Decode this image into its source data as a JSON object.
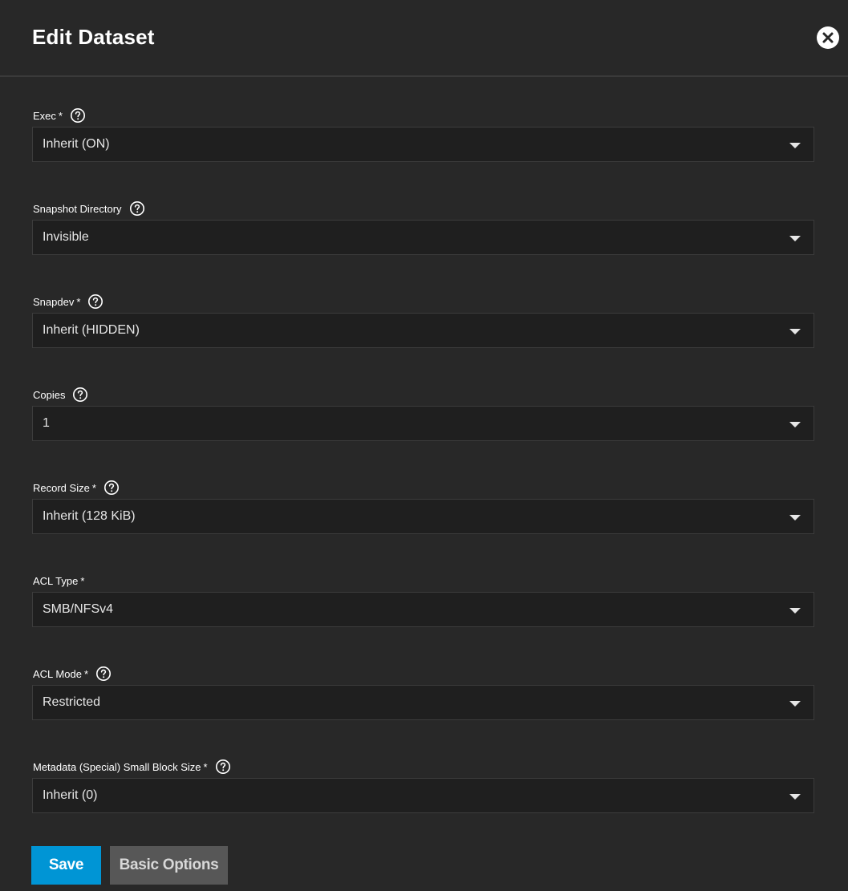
{
  "dialog": {
    "title": "Edit Dataset",
    "close_icon": "close-icon"
  },
  "fields": [
    {
      "label": "Exec",
      "required": "*",
      "has_help": true,
      "value": "Inherit (ON)"
    },
    {
      "label": "Snapshot Directory",
      "required": "",
      "has_help": true,
      "value": "Invisible"
    },
    {
      "label": "Snapdev",
      "required": "*",
      "has_help": true,
      "value": "Inherit (HIDDEN)"
    },
    {
      "label": "Copies",
      "required": "",
      "has_help": true,
      "value": "1"
    },
    {
      "label": "Record Size",
      "required": "*",
      "has_help": true,
      "value": "Inherit (128 KiB)"
    },
    {
      "label": "ACL Type",
      "required": "*",
      "has_help": false,
      "value": "SMB/NFSv4"
    },
    {
      "label": "ACL Mode",
      "required": "*",
      "has_help": true,
      "value": "Restricted"
    },
    {
      "label": "Metadata (Special) Small Block Size",
      "required": "*",
      "has_help": true,
      "value": "Inherit (0)"
    }
  ],
  "actions": {
    "save_label": "Save",
    "basic_options_label": "Basic Options"
  },
  "colors": {
    "background": "#282828",
    "input_background": "#1f1f1f",
    "primary": "#0095d5",
    "secondary_button": "#575757"
  },
  "icons": {
    "help": "help-circle-icon",
    "dropdown": "caret-down-icon"
  }
}
